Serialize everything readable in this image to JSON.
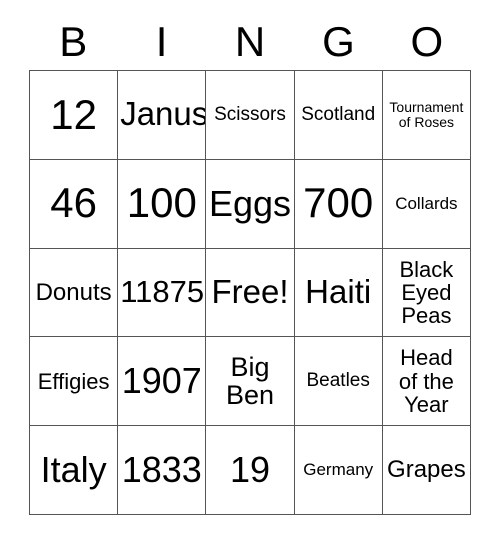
{
  "card": {
    "title": "BINGO",
    "header_letters": [
      "B",
      "I",
      "N",
      "G",
      "O"
    ],
    "columns": 5,
    "rows": 5,
    "border_color": "#555555",
    "background_color": "#ffffff",
    "text_color": "#000000",
    "free_space_label": "Free!",
    "free_space_position": "row 3, column 3",
    "cells": [
      [
        {
          "text": "12",
          "size": "fs-xxl"
        },
        {
          "text": "Janus",
          "size": "fs-l"
        },
        {
          "text": "Scissors",
          "size": "fs-xs"
        },
        {
          "text": "Scotland",
          "size": "fs-xs"
        },
        {
          "text": "Tournament\nof Roses",
          "size": "fs-tiny"
        }
      ],
      [
        {
          "text": "46",
          "size": "fs-xxl"
        },
        {
          "text": "100",
          "size": "fs-xxl"
        },
        {
          "text": "Eggs",
          "size": "fs-xl"
        },
        {
          "text": "700",
          "size": "fs-xxl"
        },
        {
          "text": "Collards",
          "size": "fs-xxs"
        }
      ],
      [
        {
          "text": "Donuts",
          "size": "fs-sm"
        },
        {
          "text": "11875",
          "size": "fs-ml"
        },
        {
          "text": "Free!",
          "size": "fs-l"
        },
        {
          "text": "Haiti",
          "size": "fs-l"
        },
        {
          "text": "Black\nEyed\nPeas",
          "size": "fs-s"
        }
      ],
      [
        {
          "text": "Effigies",
          "size": "fs-s"
        },
        {
          "text": "1907",
          "size": "fs-xl"
        },
        {
          "text": "Big\nBen",
          "size": "fs-m"
        },
        {
          "text": "Beatles",
          "size": "fs-xs"
        },
        {
          "text": "Head\nof the\nYear",
          "size": "fs-s"
        }
      ],
      [
        {
          "text": "Italy",
          "size": "fs-xl"
        },
        {
          "text": "1833",
          "size": "fs-xl"
        },
        {
          "text": "19",
          "size": "fs-xl"
        },
        {
          "text": "Germany",
          "size": "fs-xxs"
        },
        {
          "text": "Grapes",
          "size": "fs-sm"
        }
      ]
    ]
  }
}
